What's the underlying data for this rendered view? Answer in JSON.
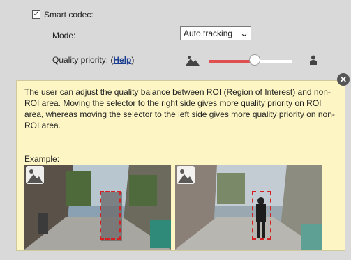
{
  "smart_codec": {
    "label": "Smart codec:",
    "checked": true
  },
  "mode": {
    "label": "Mode:",
    "selected": "Auto tracking"
  },
  "quality_priority": {
    "label": "Quality priority: (",
    "help": "Help",
    "label_end": ")",
    "level": 0.55
  },
  "tooltip": {
    "text": "The user can adjust the quality balance between ROI (Region of Interest) and non-ROI area. Moving the selector to the right side gives more quality priority on ROI area, whereas moving the selector to the left side gives more quality priority on non-ROI area.",
    "example_label": "Example:"
  },
  "icons": {
    "landscape": "landscape-icon",
    "person": "person-icon",
    "close": "close-icon"
  },
  "colors": {
    "accent": "#e05050",
    "tooltip_bg": "#fdf6c4",
    "roi": "#d42020"
  }
}
